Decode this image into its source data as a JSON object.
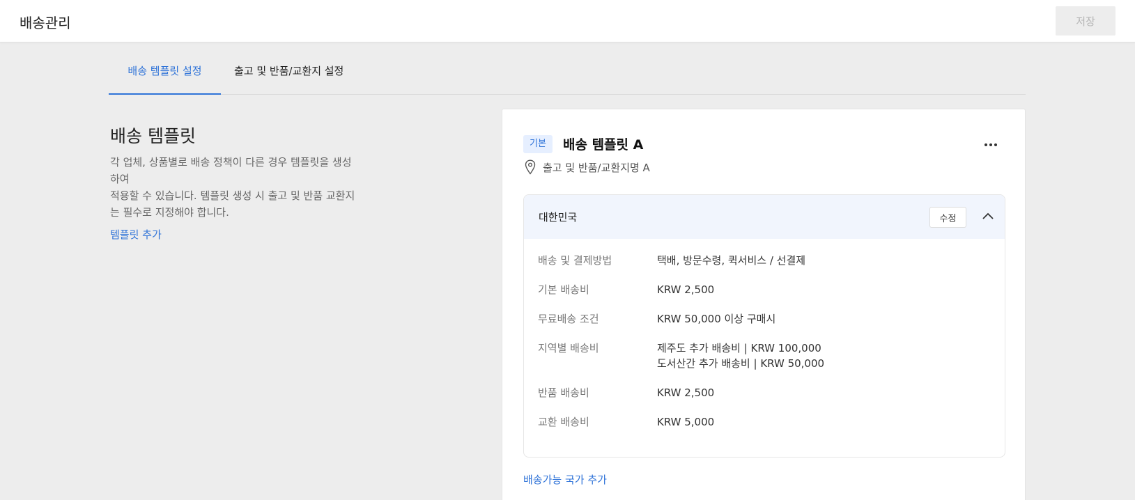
{
  "header": {
    "title": "배송관리",
    "save_label": "저장"
  },
  "tabs": [
    {
      "label": "배송 템플릿 설정",
      "active": true
    },
    {
      "label": "출고 및 반품/교환지 설정",
      "active": false
    }
  ],
  "intro": {
    "title": "배송 템플릿",
    "description_lines": [
      "각 업체, 상품별로 배송 정책이 다른 경우 템플릿을 생성",
      "하여",
      "적용할 수 있습니다. 템플릿 생성 시 출고 및 반품 교환지",
      "는 필수로 지정해야 합니다."
    ],
    "add_link": "템플릿 추가"
  },
  "template_card": {
    "badge": "기본",
    "title": "배송 템플릿 A",
    "more_icon": "more-horizontal-icon",
    "location_icon": "map-pin-icon",
    "address": "출고 및 반품/교환지명 A",
    "country": {
      "name": "대한민국",
      "edit_label": "수정",
      "collapse_icon": "chevron-up-icon",
      "details": [
        {
          "label": "배송 및 결제방법",
          "values": [
            "택배, 방문수령, 퀵서비스 / 선결제"
          ]
        },
        {
          "label": "기본 배송비",
          "values": [
            "KRW 2,500"
          ]
        },
        {
          "label": "무료배송 조건",
          "values": [
            "KRW 50,000 이상 구매시"
          ]
        },
        {
          "label": "지역별 배송비",
          "values": [
            "제주도 추가 배송비 | KRW 100,000",
            "도서산간 추가 배송비 | KRW 50,000"
          ]
        },
        {
          "label": "반품 배송비",
          "values": [
            "KRW 2,500"
          ]
        },
        {
          "label": "교환 배송비",
          "values": [
            "KRW 5,000"
          ]
        }
      ]
    },
    "add_country_link": "배송가능 국가 추가"
  },
  "colors": {
    "accent": "#2f73d8",
    "background": "#ededed",
    "header_bg": "#f1f5fd"
  }
}
